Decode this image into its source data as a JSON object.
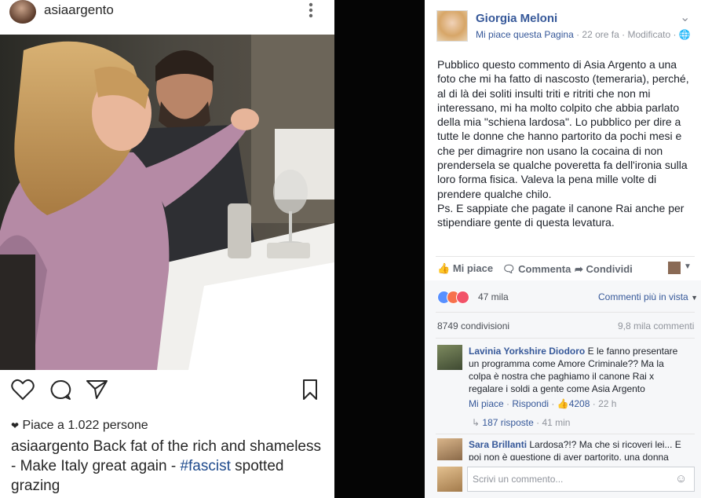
{
  "instagram": {
    "username": "asiaargento",
    "likes_text": "Piace a 1.022 persone",
    "caption_user": "asiaargento",
    "caption_text": " Back fat of the rich and shameless - Make Italy great again - ",
    "caption_tag": "#fascist",
    "caption_end": " spotted grazing"
  },
  "facebook": {
    "page_name": "Giorgia Meloni",
    "like_page": "Mi piace questa Pagina",
    "meta": " · 22 ore fa · Modificato · ",
    "post_paragraphs": [
      "Pubblico questo commento di Asia Argento a una foto che mi ha fatto di nascosto (temeraria), perché, al di là dei soliti insulti triti e ritriti che non mi interessano, mi ha molto colpito che abbia parlato della mia \"schiena lardosa\". Lo pubblico per dire a tutte le donne che hanno partorito da pochi mesi e che per dimagrire non usano la cocaina di non prendersela se qualche poveretta fa dell'ironia sulla loro forma fisica. Valeva la pena mille volte di prendere qualche chilo.",
      "Ps. E sappiate che pagate il canone Rai anche per stipendiare gente di questa levatura."
    ],
    "actions": {
      "like": "Mi piace",
      "comment": "Commenta",
      "share": "Condividi"
    },
    "reactions_count": "47 mila",
    "sort_label": "Commenti più in vista",
    "shares": "8749 condivisioni",
    "comments_count": "9,8 mila commenti",
    "comments": [
      {
        "author": "Lavinia Yorkshire Diodoro",
        "text": " E le fanno presentare un programma come Amore Criminale?? Ma la colpa è nostra che paghiamo il canone Rai x regalare i soldi a gente come Asia Argento",
        "like": "Mi piace",
        "reply": "Rispondi",
        "likes": "4208",
        "time": "22 h",
        "replies": "187 risposte",
        "replies_time": "41 min"
      },
      {
        "author": "Sara Brillanti",
        "text": " Lardosa?!? Ma che si ricoveri lei... E poi non è questione di aver partorito, una donna"
      }
    ],
    "comment_placeholder": "Scrivi un commento...",
    "colors": {
      "link": "#365899",
      "grey": "#90949c",
      "like_blue": "#5890ff",
      "angry": "#f7714c",
      "love": "#f25268"
    }
  }
}
